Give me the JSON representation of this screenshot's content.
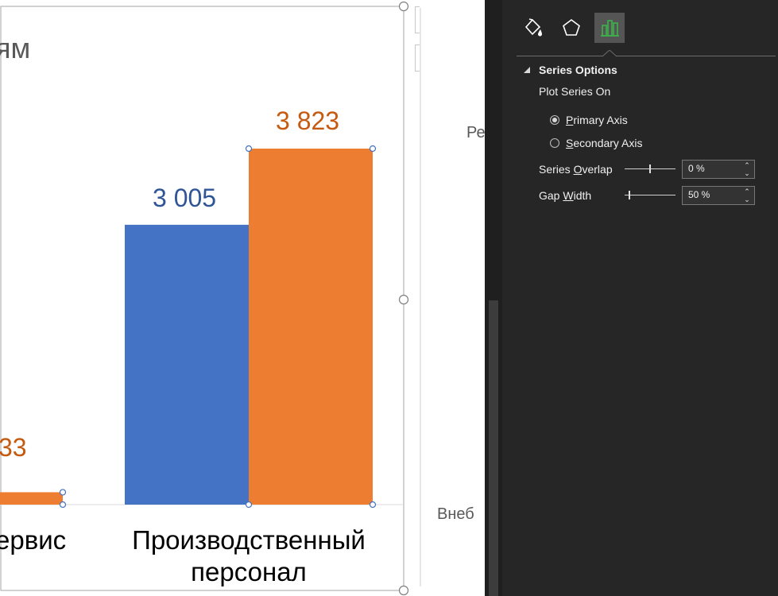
{
  "chart_title_partial": "ям",
  "chart_data": {
    "type": "bar",
    "categories": [
      "Сервис",
      "Производственный персонал"
    ],
    "category_label_visible": [
      "ервис",
      "Производственный",
      "персонал"
    ],
    "series": [
      {
        "color": "#4472C4",
        "values": [
          null,
          3005
        ],
        "labels": [
          "",
          "3 005"
        ]
      },
      {
        "color": "#ED7D31",
        "values": [
          133,
          3823
        ],
        "labels": [
          "33",
          "3 823"
        ]
      }
    ]
  },
  "colors": {
    "blue": "#4472C4",
    "orange": "#ED7D31",
    "blue_label": "#2F5597",
    "orange_label": "#C55A11",
    "pane_bg": "#262626"
  },
  "background_chart": {
    "label_top": "Ре",
    "label_bottom": "Внеб"
  },
  "chart_side_buttons": [
    {
      "icon": "plus-icon"
    },
    {
      "icon": "brush-icon"
    }
  ],
  "pane": {
    "tabs": [
      {
        "icon": "fill-line-icon"
      },
      {
        "icon": "effects-pentagon-icon"
      },
      {
        "icon": "series-options-bar-chart-icon",
        "selected": true
      }
    ],
    "section_title": "Series Options",
    "plot_on_label": "Plot Series On",
    "primary_axis": {
      "pre": "",
      "u": "P",
      "post": "rimary Axis",
      "selected": true
    },
    "secondary_axis": {
      "pre": "",
      "u": "S",
      "post": "econdary Axis",
      "selected": false
    },
    "overlap": {
      "pre": "Series ",
      "u": "O",
      "post": "verlap",
      "value": "0 %",
      "level_percent": 0
    },
    "gap": {
      "pre": "Gap ",
      "u": "W",
      "post": "idth",
      "value": "50 %",
      "level_percent": 50
    }
  }
}
